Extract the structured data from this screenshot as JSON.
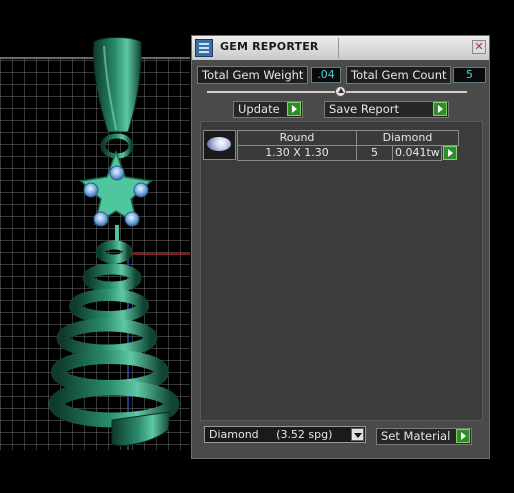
{
  "window": {
    "title": "GEM REPORTER"
  },
  "stats": {
    "total_weight_label": "Total Gem Weight",
    "total_weight_value": ".04",
    "total_count_label": "Total Gem Count",
    "total_count_value": "5"
  },
  "actions": {
    "update_label": "Update",
    "save_report_label": "Save Report"
  },
  "gem_list": {
    "headers": [
      "Round",
      "Diamond"
    ],
    "rows": [
      {
        "size": "1.30 X 1.30",
        "count": "5",
        "weight": "0.041tw"
      }
    ]
  },
  "material": {
    "selected": "Diamond     (3.52 spg)",
    "set_label": "Set Material"
  },
  "colors": {
    "panel": "#4a4a4a",
    "accent_green": "#2f8d2c",
    "value_cyan": "#49d3e6",
    "model_green": "#2a8a6c"
  }
}
